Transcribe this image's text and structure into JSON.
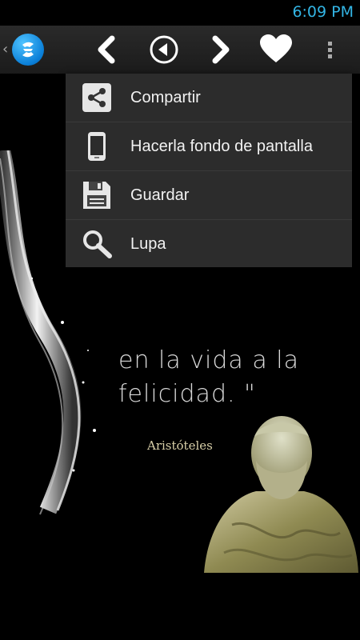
{
  "status_bar": {
    "time": "6:09 PM",
    "accent": "#33b5e5"
  },
  "action_bar": {
    "icons": [
      "app-logo",
      "back-arrow-icon",
      "play-back-icon",
      "forward-arrow-icon",
      "heart-icon",
      "overflow-menu-icon"
    ]
  },
  "menu": {
    "items": [
      {
        "label": "Compartir",
        "icon": "share-icon"
      },
      {
        "label": "Hacerla fondo de pantalla",
        "icon": "phone-icon"
      },
      {
        "label": "Guardar",
        "icon": "save-icon"
      },
      {
        "label": "Lupa",
        "icon": "magnifier-icon"
      }
    ]
  },
  "wallpaper": {
    "quote_lines": [
      "en la vida a la",
      "felicidad. \""
    ],
    "author": "Aristóteles"
  }
}
